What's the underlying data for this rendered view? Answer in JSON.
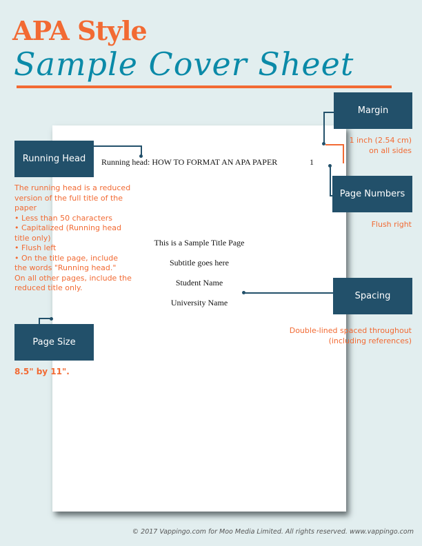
{
  "header": {
    "title_line1": "APA Style",
    "title_line2": "Sample Cover Sheet"
  },
  "sample_page": {
    "running_head": "Running head: HOW TO FORMAT AN APA PAPER",
    "page_number": "1",
    "title": "This is a Sample Title Page",
    "subtitle": "Subtitle goes here",
    "student_name": "Student Name",
    "university_name": "University Name"
  },
  "callouts": {
    "margin": {
      "label": "Margin",
      "note_lines": [
        "1 inch (2.54 cm)",
        "on all sides"
      ]
    },
    "running_head": {
      "label": "Running Head",
      "note_lines": [
        "The running head is a reduced",
        "version of the full title of the",
        "paper",
        "• Less than 50 characters",
        "• Capitalized (Running head",
        "title only)",
        "• Flush left",
        "• On the title page, include",
        "the words \"Running head.\"",
        "On all other pages, include the",
        "reduced title only."
      ]
    },
    "page_numbers": {
      "label": "Page Numbers",
      "note": "Flush right"
    },
    "spacing": {
      "label": "Spacing",
      "note_lines": [
        "Double-lined spaced throughout",
        "(including references)"
      ]
    },
    "page_size": {
      "label": "Page Size",
      "note": "8.5\" by 11\"."
    }
  },
  "colors": {
    "accent_orange": "#f26a33",
    "title_blue": "#0b8aa8",
    "box_navy": "#22506a",
    "background": "#e2eeef"
  },
  "footer": "© 2017 Vappingo.com for Moo Media Limited. All rights reserved. www.vappingo.com"
}
